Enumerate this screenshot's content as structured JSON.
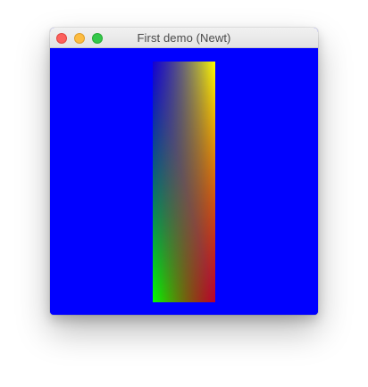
{
  "window": {
    "title": "First demo (Newt)"
  },
  "colors": {
    "background": "#0000ff",
    "gradient_top_left": "#0000ff",
    "gradient_top_right": "#ffff00",
    "gradient_bottom_left": "#00ff00",
    "gradient_bottom_right": "#ff0000"
  }
}
